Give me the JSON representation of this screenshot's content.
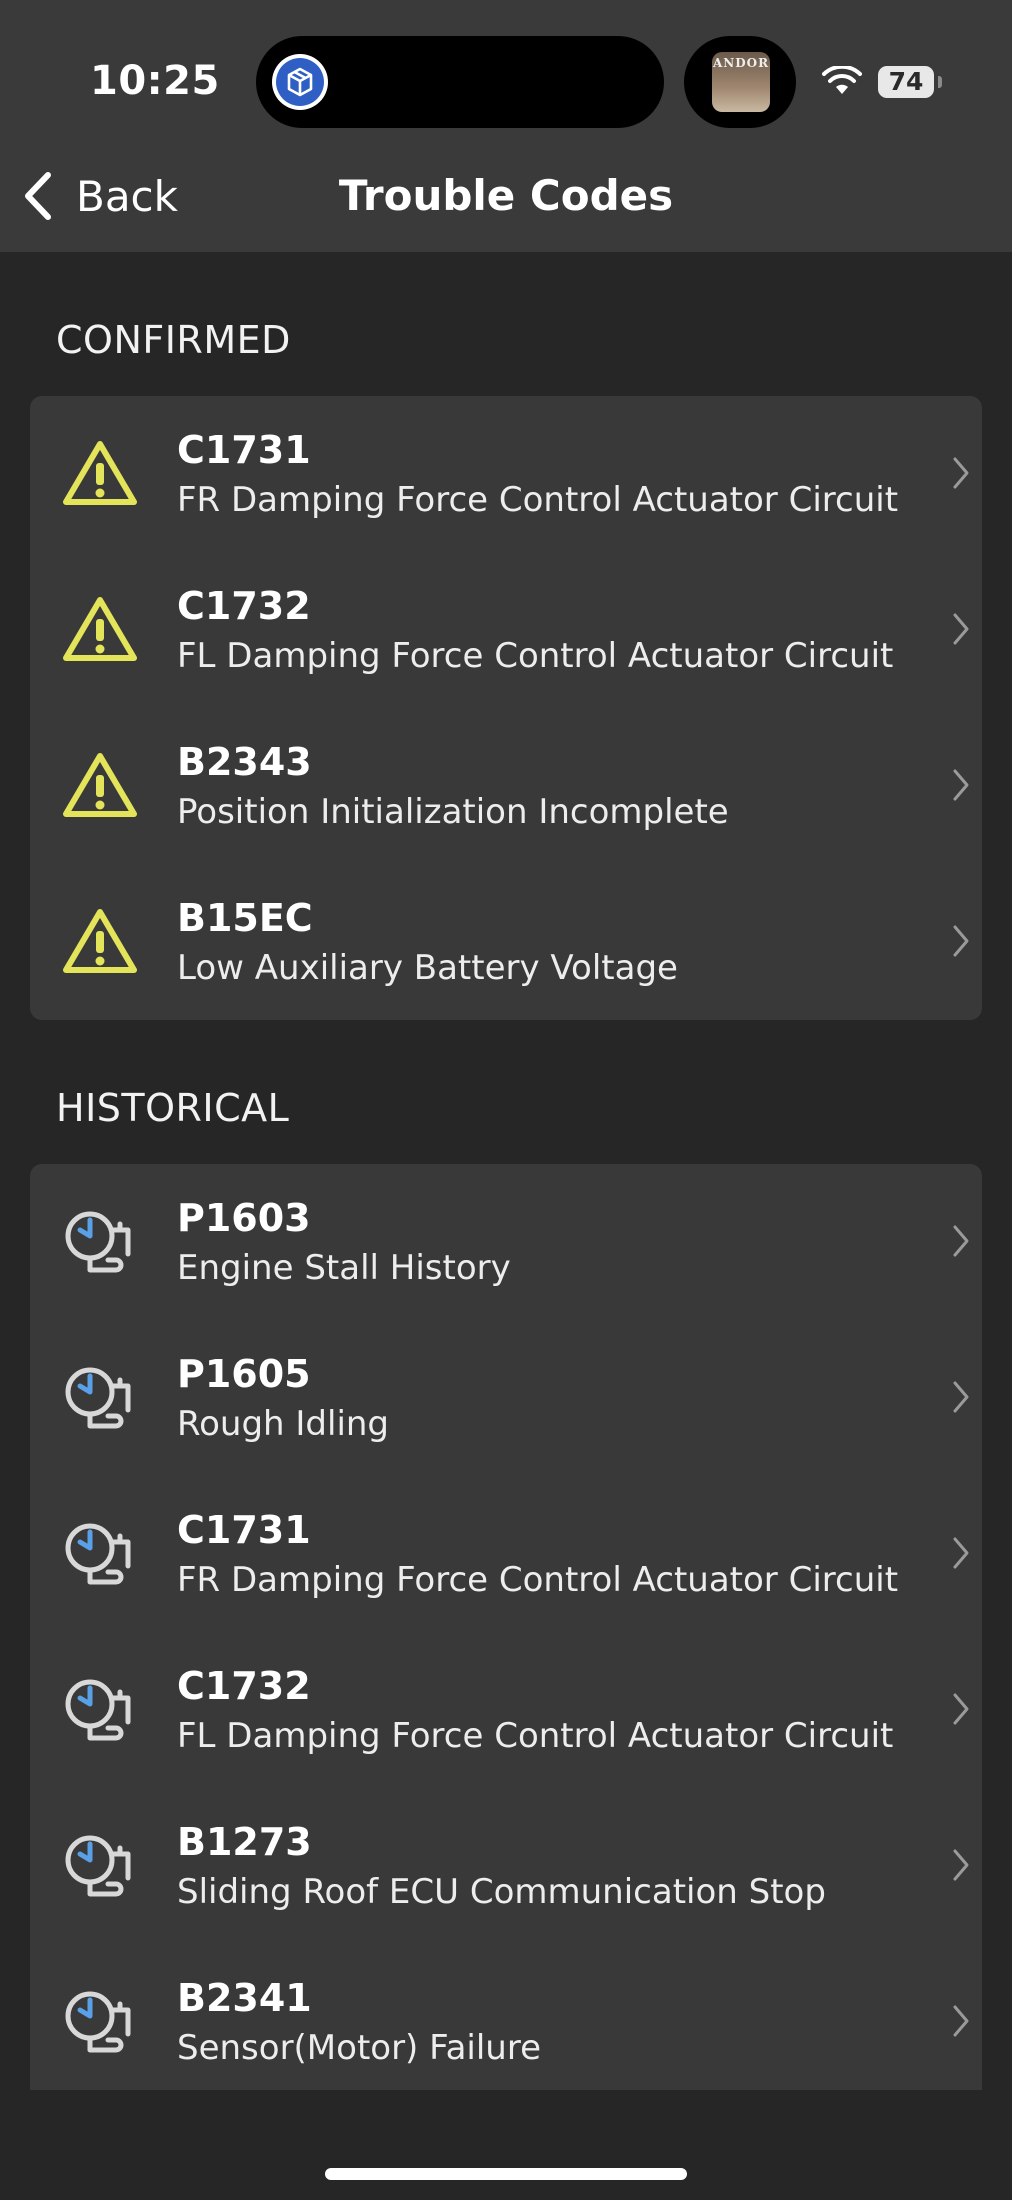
{
  "status_bar": {
    "time": "10:25",
    "battery": "74",
    "island_art_text": "ANDOR"
  },
  "nav": {
    "back_label": "Back",
    "title": "Trouble Codes"
  },
  "sections": [
    {
      "header": "CONFIRMED",
      "icon": "warning-icon",
      "items": [
        {
          "code": "C1731",
          "description": "FR Damping Force Control Actuator Circuit"
        },
        {
          "code": "C1732",
          "description": "FL Damping Force Control Actuator Circuit"
        },
        {
          "code": "B2343",
          "description": "Position Initialization Incomplete"
        },
        {
          "code": "B15EC",
          "description": "Low Auxiliary Battery Voltage"
        }
      ]
    },
    {
      "header": "HISTORICAL",
      "icon": "history-clock-icon",
      "items": [
        {
          "code": "P1603",
          "description": "Engine Stall History"
        },
        {
          "code": "P1605",
          "description": "Rough Idling"
        },
        {
          "code": "C1731",
          "description": "FR Damping Force Control Actuator Circuit"
        },
        {
          "code": "C1732",
          "description": "FL Damping Force Control Actuator Circuit"
        },
        {
          "code": "B1273",
          "description": "Sliding Roof ECU Communication Stop"
        },
        {
          "code": "B2341",
          "description": "Sensor(Motor) Failure"
        }
      ]
    }
  ],
  "colors": {
    "warning": "#e4e45a",
    "history_accent": "#5aa0e6",
    "background": "#262626",
    "card": "#393939"
  }
}
